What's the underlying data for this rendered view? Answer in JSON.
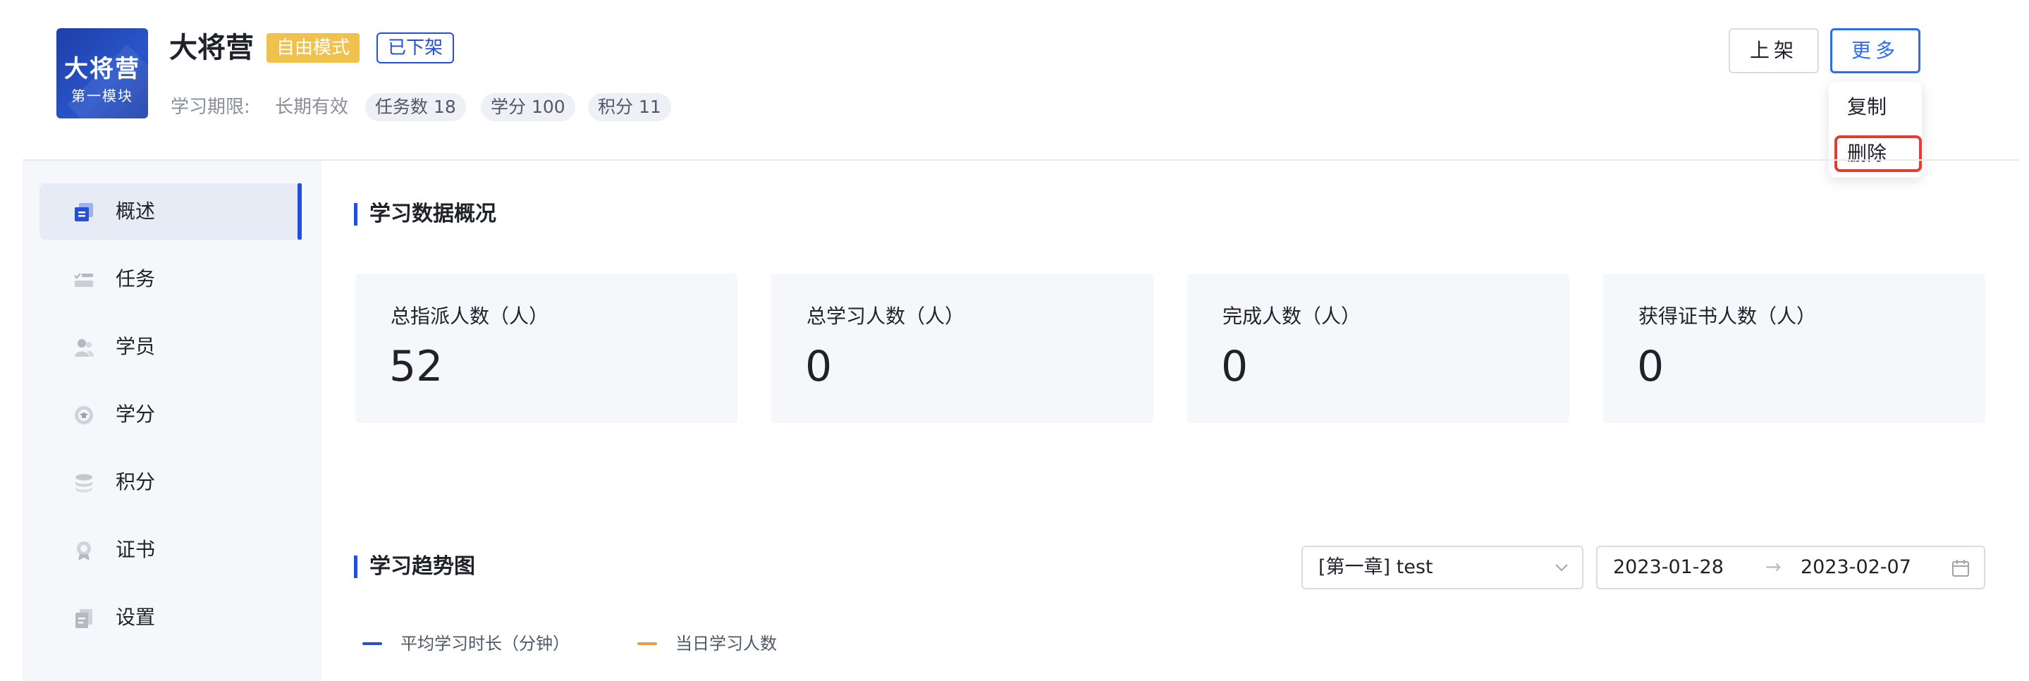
{
  "header": {
    "cover": {
      "title": "大将营",
      "subtitle": "第一模块"
    },
    "title": "大将营",
    "mode_tag": "自由模式",
    "status_tag": "已下架",
    "period_label": "学习期限:",
    "period_value": "长期有效",
    "pills": [
      "任务数 18",
      "学分 100",
      "积分 11"
    ],
    "shelf_button": "上架",
    "more_button": "更多",
    "more_menu": [
      "复制",
      "删除"
    ]
  },
  "sidebar": {
    "items": [
      {
        "label": "概述",
        "icon": "overview-icon",
        "active": true
      },
      {
        "label": "任务",
        "icon": "task-icon",
        "active": false
      },
      {
        "label": "学员",
        "icon": "student-icon",
        "active": false
      },
      {
        "label": "学分",
        "icon": "credit-icon",
        "active": false
      },
      {
        "label": "积分",
        "icon": "points-icon",
        "active": false
      },
      {
        "label": "证书",
        "icon": "certificate-icon",
        "active": false
      },
      {
        "label": "设置",
        "icon": "settings-icon",
        "active": false
      }
    ]
  },
  "overview": {
    "title": "学习数据概况",
    "stats": [
      {
        "label": "总指派人数（人）",
        "value": "52"
      },
      {
        "label": "总学习人数（人）",
        "value": "0"
      },
      {
        "label": "完成人数（人）",
        "value": "0"
      },
      {
        "label": "获得证书人数（人）",
        "value": "0"
      }
    ]
  },
  "trend": {
    "title": "学习趋势图",
    "chapter_select": "[第一章] test",
    "date_start": "2023-01-28",
    "date_separator": "→",
    "date_end": "2023-02-07",
    "legend": [
      {
        "label": "平均学习时长（分钟）",
        "color": "#2450d6"
      },
      {
        "label": "当日学习人数",
        "color": "#e6a23c"
      }
    ]
  },
  "colors": {
    "primary": "#2450d6",
    "accent_blue": "#2f6cf6",
    "mode_tag": "#f0c14d",
    "highlight_red": "#e43d30"
  }
}
